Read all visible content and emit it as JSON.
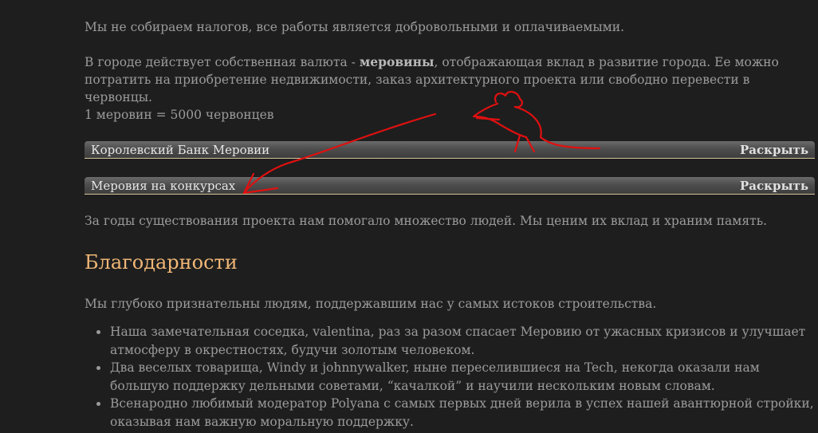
{
  "intro": {
    "taxes": "Мы не собираем налогов, все работы является добровольными и оплачиваемыми.",
    "currency_before": "В городе действует собственная валюта - ",
    "currency_bold": "меровины",
    "currency_after": ", отображающая вклад в развитие города. Ее можно потратить на приобретение недвижимости, заказ архитектурного проекта или свободно перевести в червонцы.",
    "rate": "1 меровин = 5000 червонцев"
  },
  "spoilers": [
    {
      "title": "Королевский Банк Меровии",
      "toggle": "Раскрыть"
    },
    {
      "title": "Меровия на конкурсах",
      "toggle": "Раскрыть"
    }
  ],
  "history": "За годы существования проекта нам помогало множество людей. Мы ценим их вклад и храним память.",
  "thanks": {
    "heading": "Благодарности",
    "intro": "Мы глубоко признательны людям, поддержавшим нас у самых истоков строительства.",
    "items": [
      "Наша замечательная соседка, valentina, раз за разом спасает Меровию от ужасных кризисов и улучшает атмосферу в окрестностях, будучи золотым человеком.",
      "Два веселых товарища, Windy и johnnywalker, ныне переселившиеся на Tech, некогда оказали нам большую поддержку дельными советами, “качалкой” и научили нескольким новым словам.",
      "Всенародно любимый модератор Polyana с самых первых дней верила в успех нашей авантюрной стройки, оказывая нам важную моральную поддержку."
    ]
  },
  "colors": {
    "background": "#1e1e1e",
    "text": "#9b9b9b",
    "heading": "#f0b777",
    "annotation": "#e01010"
  }
}
